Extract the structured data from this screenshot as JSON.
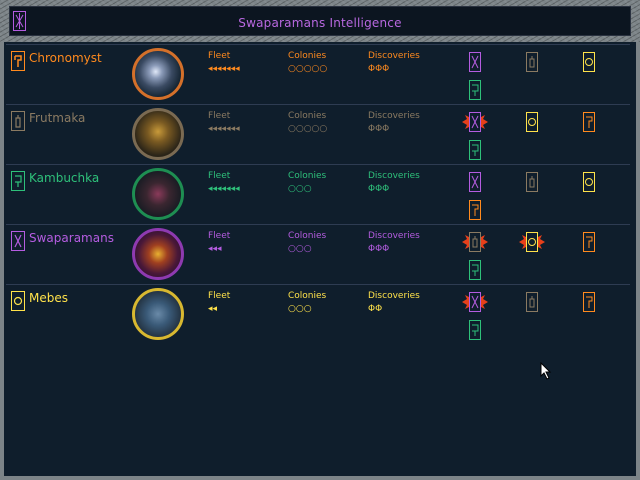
{
  "window": {
    "title": "Swaparamans Intelligence"
  },
  "columns": {
    "fleet": "Fleet",
    "colonies": "Colonies",
    "discoveries": "Discoveries"
  },
  "races": [
    {
      "name": "Chronomyst",
      "color": "#ff8a1e",
      "emblem": "chronomyst-emblem-icon",
      "portrait": "chronomyst-portrait",
      "fleet": "◂◂◂◂◂◂◂",
      "colonies": "○○○○○",
      "discoveries": "ΦΦΦ",
      "symcolor": "#ff8a1e",
      "lblcolor": "#ff8a1e"
    },
    {
      "name": "Frutmaka",
      "color": "#8a7a62",
      "emblem": "frutmaka-emblem-icon",
      "portrait": "frutmaka-portrait",
      "fleet": "◂◂◂◂◂◂◂",
      "colonies": "○○○○○",
      "discoveries": "ΦΦΦ",
      "symcolor": "#8a7a62",
      "lblcolor": "#8a7a62"
    },
    {
      "name": "Kambuchka",
      "color": "#2ec07a",
      "emblem": "kambuchka-emblem-icon",
      "portrait": "kambuchka-portrait",
      "fleet": "◂◂◂◂◂◂◂",
      "colonies": "○○○",
      "discoveries": "ΦΦΦ",
      "symcolor": "#2ec07a",
      "lblcolor": "#2ec07a"
    },
    {
      "name": "Swaparamans",
      "color": "#b45ce0",
      "emblem": "swaparamans-emblem-icon",
      "portrait": "swaparamans-portrait",
      "fleet": "◂◂◂",
      "colonies": "○○○",
      "discoveries": "ΦΦΦ",
      "symcolor": "#b45ce0",
      "lblcolor": "#b45ce0"
    },
    {
      "name": "Mebes",
      "color": "#ffe24a",
      "emblem": "mebes-emblem-icon",
      "portrait": "mebes-portrait",
      "fleet": "◂◂",
      "colonies": "○○○",
      "discoveries": "ΦΦ",
      "symcolor": "#ffe24a",
      "lblcolor": "#ffe24a"
    }
  ],
  "colors": {
    "background": "#0f1e2c",
    "frame": "#7c8488",
    "title": "#b868e0"
  }
}
